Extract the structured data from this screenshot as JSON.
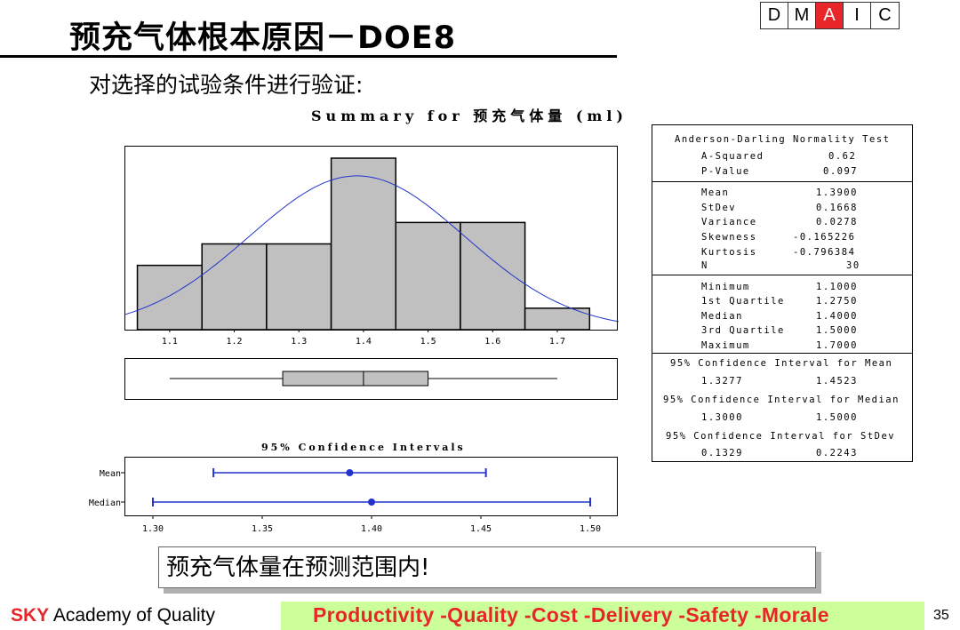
{
  "header": {
    "title": "预充气体根本原因－DOE8",
    "dmaic": [
      {
        "label": "D",
        "active": false
      },
      {
        "label": "M",
        "active": false
      },
      {
        "label": "A",
        "active": true
      },
      {
        "label": "I",
        "active": false
      },
      {
        "label": "C",
        "active": false
      }
    ],
    "subtitle": "对选择的试验条件进行验证:"
  },
  "chart_data": [
    {
      "type": "bar",
      "title": "Summary for 预充气体量 (ml)",
      "bins": [
        {
          "from": 1.05,
          "to": 1.15,
          "count": 3
        },
        {
          "from": 1.15,
          "to": 1.25,
          "count": 4
        },
        {
          "from": 1.25,
          "to": 1.35,
          "count": 4
        },
        {
          "from": 1.35,
          "to": 1.45,
          "count": 8
        },
        {
          "from": 1.45,
          "to": 1.55,
          "count": 5
        },
        {
          "from": 1.55,
          "to": 1.65,
          "count": 5
        },
        {
          "from": 1.65,
          "to": 1.75,
          "count": 1
        }
      ],
      "ymax": 8,
      "normal_curve": {
        "mean": 1.39,
        "stdev": 0.1668,
        "n": 30,
        "bin_width": 0.1
      },
      "xlim": [
        1.03,
        1.795
      ],
      "xticks": [
        "1.1",
        "1.2",
        "1.3",
        "1.4",
        "1.5",
        "1.6",
        "1.7"
      ],
      "boxplot": {
        "whisker_low": 1.1,
        "q1": 1.275,
        "median": 1.4,
        "q3": 1.5,
        "whisker_high": 1.7
      }
    },
    {
      "type": "scatter",
      "title": "95% Confidence Intervals",
      "xlim": [
        1.3,
        1.5
      ],
      "xticks": [
        "1.30",
        "1.35",
        "1.40",
        "1.45",
        "1.50"
      ],
      "intervals": [
        {
          "name": "Mean",
          "low": 1.3277,
          "high": 1.4523,
          "point": 1.39
        },
        {
          "name": "Median",
          "low": 1.3,
          "high": 1.5,
          "point": 1.4
        }
      ]
    }
  ],
  "stats": {
    "ad_title": "Anderson-Darling Normality Test",
    "ad_rows": [
      [
        "A-Squared",
        "0.62"
      ],
      [
        "P-Value",
        "0.097"
      ]
    ],
    "desc_rows": [
      [
        "Mean",
        "1.3900"
      ],
      [
        "StDev",
        "0.1668"
      ],
      [
        "Variance",
        "0.0278"
      ],
      [
        "Skewness",
        "-0.165226"
      ],
      [
        "Kurtosis",
        "-0.796384"
      ],
      [
        "N",
        "30"
      ]
    ],
    "quart_rows": [
      [
        "Minimum",
        "1.1000"
      ],
      [
        "1st Quartile",
        "1.2750"
      ],
      [
        "Median",
        "1.4000"
      ],
      [
        "3rd Quartile",
        "1.5000"
      ],
      [
        "Maximum",
        "1.7000"
      ]
    ],
    "ci_mean_title": "95% Confidence Interval for Mean",
    "ci_mean": [
      "1.3277",
      "1.4523"
    ],
    "ci_median_title": "95% Confidence Interval for Median",
    "ci_median": [
      "1.3000",
      "1.5000"
    ],
    "ci_stdev_title": "95% Confidence Interval for StDev",
    "ci_stdev": [
      "0.1329",
      "0.2243"
    ]
  },
  "conclusion": "预充气体量在预测范围内!",
  "footer": {
    "brand": "SKY",
    "org": " Academy of Quality",
    "slogan": "Productivity  -Quality  -Cost   -Delivery  -Safety  -Morale",
    "page": "35"
  },
  "colors": {
    "accent_red": "#e8262a",
    "footer_bg": "#ccff99",
    "curve_blue": "#2233cc",
    "bar_fill": "#c0c0c0"
  }
}
